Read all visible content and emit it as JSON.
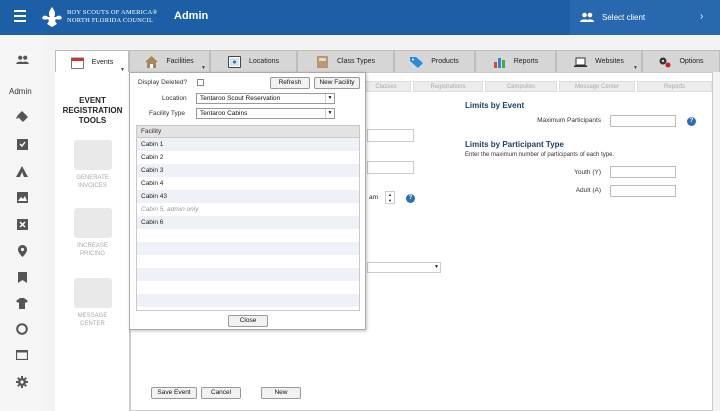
{
  "topbar": {
    "org_line1": "BOY SCOUTS OF AMERICA®",
    "org_line2": "NORTH FLORIDA COUNCIL",
    "app_title": "Admin",
    "client_label": "Select client",
    "chevron": "›"
  },
  "sidebar": {
    "section_label": "Admin"
  },
  "tabs": [
    {
      "label": "Events"
    },
    {
      "label": "Facilities"
    },
    {
      "label": "Locations"
    },
    {
      "label": "Class Types"
    },
    {
      "label": "Products"
    },
    {
      "label": "Reports"
    },
    {
      "label": "Websites"
    },
    {
      "label": "Options"
    }
  ],
  "subtabs": [
    "Classes",
    "Registrations",
    "Campsites",
    "Message Center",
    "Reports"
  ],
  "left_panel": {
    "title_line1": "EVENT",
    "title_line2": "REGISTRATION",
    "title_line3": "TOOLS",
    "tools": [
      {
        "line1": "GENERATE",
        "line2": "INVOICES"
      },
      {
        "line1": "INCREASE",
        "line2": "PRICING"
      },
      {
        "line1": "MESSAGE",
        "line2": "CENTER"
      }
    ]
  },
  "limits": {
    "by_event_heading": "Limits by Event",
    "max_participants_label": "Maximum Participants",
    "by_type_heading": "Limits by Participant Type",
    "by_type_desc": "Enter the maximum number of participants of each type.",
    "youth_label": "Youth (Y)",
    "adult_label": "Adult (A)",
    "help_glyph": "?"
  },
  "main_fields": {
    "ampm_value": "am"
  },
  "bottom_buttons": {
    "save": "Save Event",
    "cancel": "Cancel",
    "new": "New"
  },
  "popup": {
    "display_deleted_label": "Display Deleted?",
    "refresh_label": "Refresh",
    "new_facility_label": "New Facility",
    "location_label": "Location",
    "location_value": "Tentaroo Scout Reservation",
    "facility_type_label": "Facility Type",
    "facility_type_value": "Tentaroo Cabins",
    "table_header": "Facility",
    "rows": [
      "Cabin 1",
      "Cabin 2",
      "Cabin 3",
      "Cabin 4",
      "Cabin 43",
      "Cabin 5, admin only",
      "Cabin 6",
      "",
      "",
      "",
      "",
      "",
      ""
    ],
    "close_label": "Close"
  },
  "colors": {
    "brand_blue": "#1c5fa6",
    "heading_blue": "#1b3f6b",
    "help_blue": "#2f6db5"
  }
}
